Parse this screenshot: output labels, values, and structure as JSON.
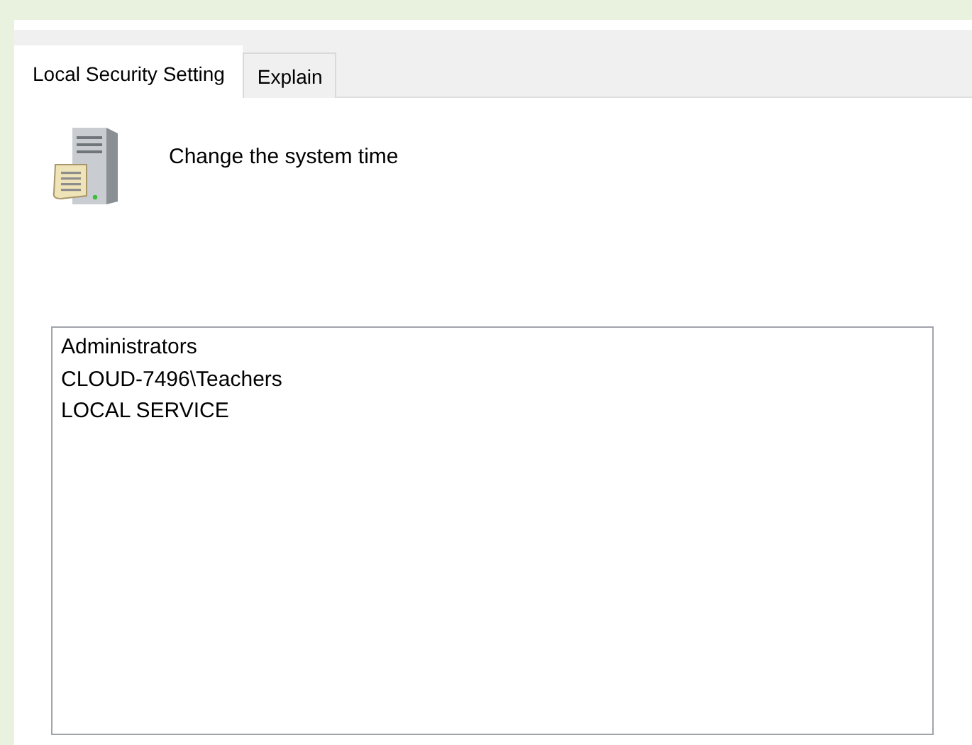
{
  "tabs": [
    {
      "label": "Local Security Setting",
      "selected": true
    },
    {
      "label": "Explain",
      "selected": false
    }
  ],
  "policy": {
    "title": "Change the system time"
  },
  "members": [
    "Administrators",
    "CLOUD-7496\\Teachers",
    "LOCAL SERVICE"
  ]
}
